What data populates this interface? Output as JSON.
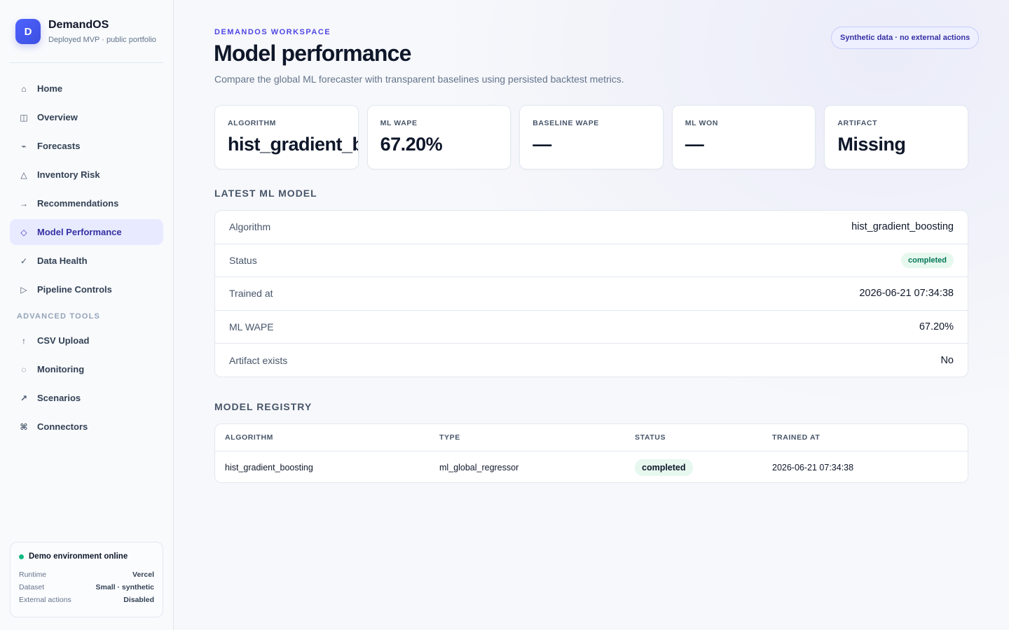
{
  "brand": {
    "logo_letter": "D",
    "name": "DemandOS",
    "subtitle": "Deployed MVP · public portfolio"
  },
  "nav": {
    "items": [
      {
        "label": "Home",
        "icon": "home-icon",
        "glyph": "⌂"
      },
      {
        "label": "Overview",
        "icon": "grid-icon",
        "glyph": "◫"
      },
      {
        "label": "Forecasts",
        "icon": "trend-icon",
        "glyph": "⌁"
      },
      {
        "label": "Inventory Risk",
        "icon": "warning-triangle-icon",
        "glyph": "△"
      },
      {
        "label": "Recommendations",
        "icon": "arrow-right-icon",
        "glyph": "→"
      },
      {
        "label": "Model Performance",
        "icon": "diamond-icon",
        "glyph": "◇",
        "active": true
      },
      {
        "label": "Data Health",
        "icon": "check-icon",
        "glyph": "✓"
      },
      {
        "label": "Pipeline Controls",
        "icon": "play-icon",
        "glyph": "▷"
      }
    ],
    "advanced_title": "ADVANCED TOOLS",
    "advanced_items": [
      {
        "label": "CSV Upload",
        "icon": "upload-arrow-icon",
        "glyph": "↑"
      },
      {
        "label": "Monitoring",
        "icon": "monitor-circle-icon",
        "glyph": "◌"
      },
      {
        "label": "Scenarios",
        "icon": "arrow-up-right-icon",
        "glyph": "↗"
      },
      {
        "label": "Connectors",
        "icon": "command-icon",
        "glyph": "⌘"
      }
    ]
  },
  "environment": {
    "title": "Demo environment online",
    "status_color": "#10b981",
    "rows": [
      {
        "key": "Runtime",
        "value": "Vercel"
      },
      {
        "key": "Dataset",
        "value": "Small · synthetic"
      },
      {
        "key": "External actions",
        "value": "Disabled"
      }
    ]
  },
  "header": {
    "eyebrow": "DEMANDOS WORKSPACE",
    "title": "Model performance",
    "subtitle": "Compare the global ML forecaster with transparent baselines using persisted backtest metrics.",
    "pill": "Synthetic data · no external actions"
  },
  "kpis": [
    {
      "label": "ALGORITHM",
      "value": "hist_gradient_boosting"
    },
    {
      "label": "ML WAPE",
      "value": "67.20%"
    },
    {
      "label": "BASELINE WAPE",
      "value": "—"
    },
    {
      "label": "ML WON",
      "value": "—"
    },
    {
      "label": "ARTIFACT",
      "value": "Missing"
    }
  ],
  "latest_model": {
    "title": "LATEST ML MODEL",
    "rows": [
      {
        "key": "Algorithm",
        "value": "hist_gradient_boosting"
      },
      {
        "key": "Status",
        "value": "completed",
        "badge": true
      },
      {
        "key": "Trained at",
        "value": "2026-06-21 07:34:38"
      },
      {
        "key": "ML WAPE",
        "value": "67.20%"
      },
      {
        "key": "Artifact exists",
        "value": "No"
      }
    ]
  },
  "registry": {
    "title": "MODEL REGISTRY",
    "columns": [
      "ALGORITHM",
      "TYPE",
      "STATUS",
      "TRAINED AT"
    ],
    "rows": [
      {
        "algorithm": "hist_gradient_boosting",
        "type": "ml_global_regressor",
        "status": "completed",
        "trained_at": "2026-06-21 07:34:38"
      }
    ]
  },
  "colors": {
    "accent": "#4f46e5",
    "success": "#047857",
    "success_bg": "#e7f8ef"
  }
}
